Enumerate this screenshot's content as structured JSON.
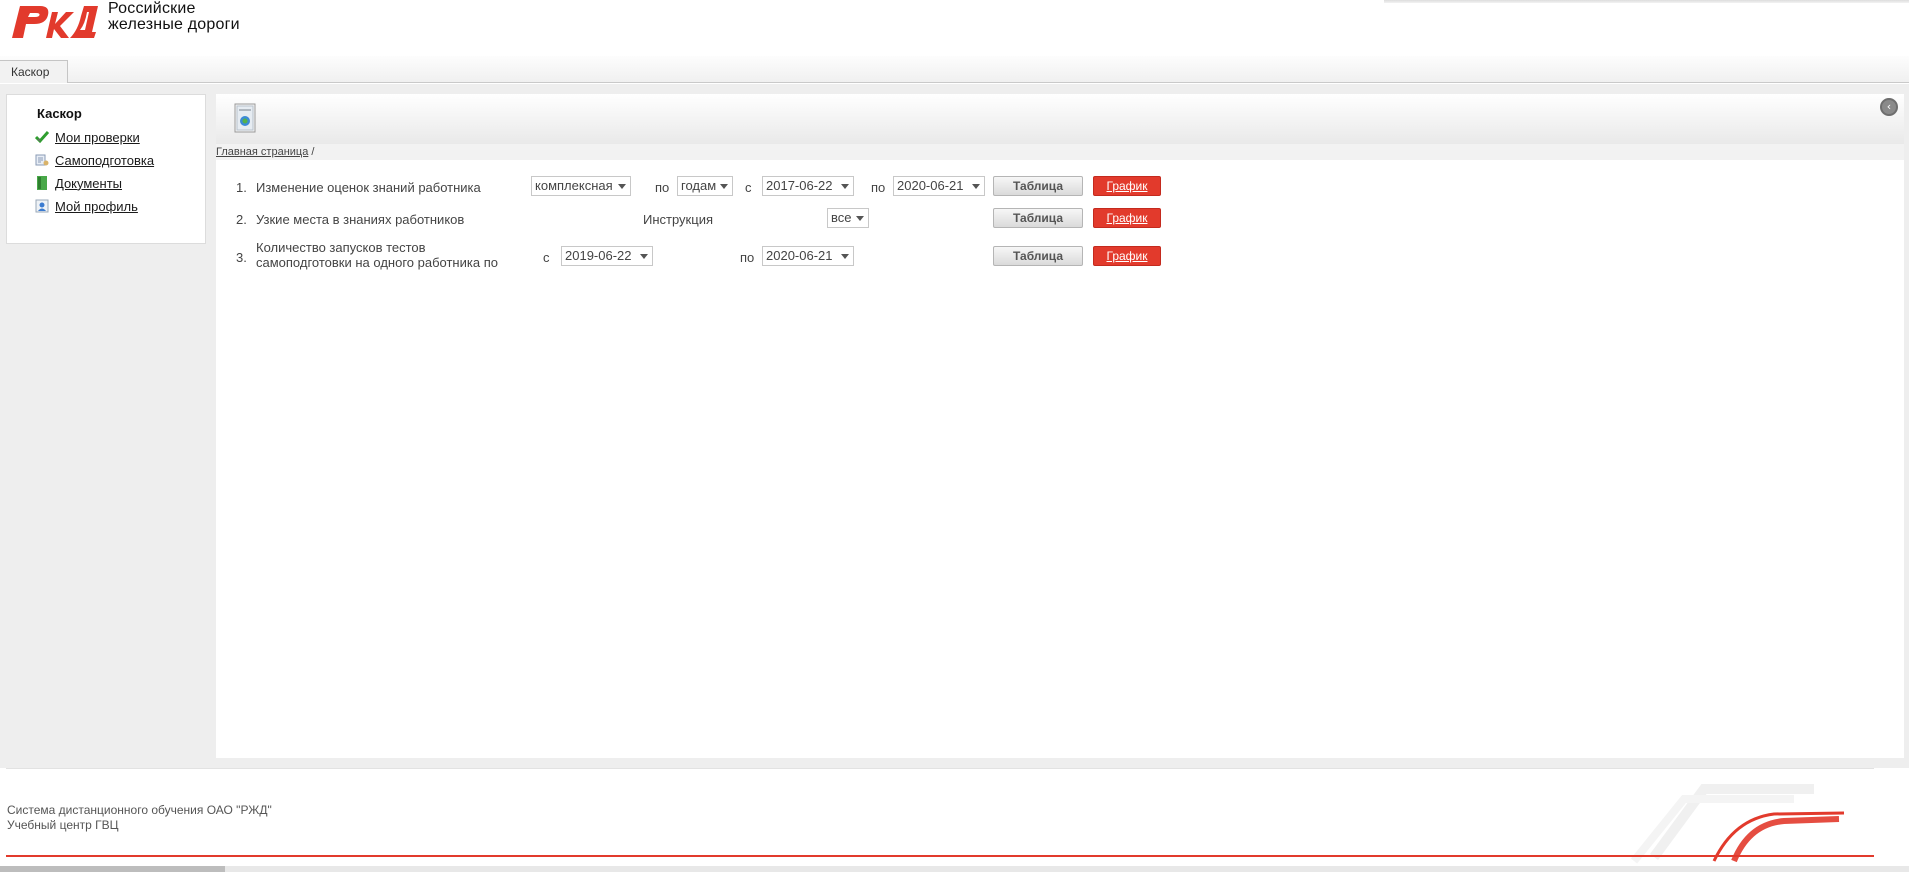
{
  "brand": {
    "logo_text": "РЖД",
    "name_line1": "Российские",
    "name_line2": "железные дороги",
    "accent": "#e23a2c"
  },
  "tabs": [
    {
      "label": "Каскор"
    }
  ],
  "sidebar": {
    "title": "Каскор",
    "items": [
      {
        "label": "Мои проверки",
        "icon": "checkmark-icon"
      },
      {
        "label": "Самоподготовка",
        "icon": "self-study-icon"
      },
      {
        "label": "Документы",
        "icon": "document-icon"
      },
      {
        "label": "Мой профиль",
        "icon": "profile-icon"
      }
    ]
  },
  "breadcrumb": {
    "home": "Главная страница",
    "separator": "/"
  },
  "reports": [
    {
      "number": "1.",
      "title": "Изменение оценок знаний работника",
      "type_select": "комплексная",
      "by_label": "по",
      "period_select": "годам",
      "from_label": "с",
      "from_date": "2017-06-22",
      "to_label": "по",
      "to_date": "2020-06-21",
      "table_btn": "Таблица",
      "chart_btn": "График"
    },
    {
      "number": "2.",
      "title": "Узкие места в знаниях работников",
      "instruction_label": "Инструкция",
      "filter_select": "все",
      "table_btn": "Таблица",
      "chart_btn": "График"
    },
    {
      "number": "3.",
      "title_line1": "Количество запусков тестов",
      "title_line2": "самоподготовки на одного работника по",
      "from_label": "с",
      "from_date": "2019-06-22",
      "to_label": "по",
      "to_date": "2020-06-21",
      "table_btn": "Таблица",
      "chart_btn": "График"
    }
  ],
  "footer": {
    "line1": "Система дистанционного обучения ОАО \"РЖД\"",
    "line2": "Учебный центр ГВЦ"
  }
}
